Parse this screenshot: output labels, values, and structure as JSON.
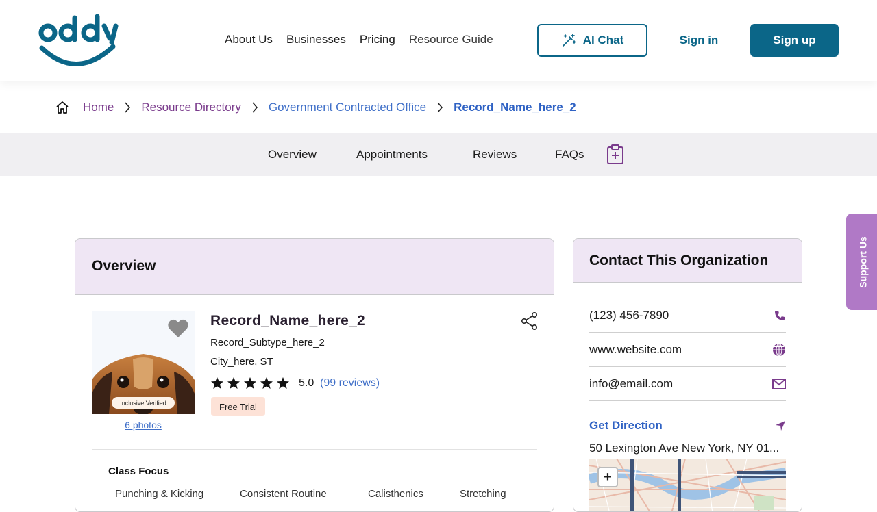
{
  "brand": {
    "logo_text": "oddy",
    "color": "#0b6688"
  },
  "nav": {
    "items": [
      "About Us",
      "Businesses",
      "Pricing",
      "Resource Guide"
    ],
    "ai_chat": "AI Chat",
    "sign_in": "Sign in",
    "sign_up": "Sign up"
  },
  "breadcrumb": {
    "home": "Home",
    "directory": "Resource Directory",
    "category": "Government Contracted Office",
    "current": "Record_Name_here_2"
  },
  "tabs": [
    "Overview",
    "Appointments",
    "Reviews",
    "FAQs"
  ],
  "support": "Support Us",
  "overview": {
    "heading": "Overview",
    "name": "Record_Name_here_2",
    "subtype": "Record_Subtype_here_2",
    "city": "City_here, ST",
    "stars": 5,
    "rating": "5.0",
    "reviews": "(99 reviews)",
    "badge": "Free Trial",
    "verified": "Inclusive Verified",
    "photos": "6 photos",
    "class_focus": "Class Focus",
    "focus_items": [
      "Punching & Kicking",
      "Consistent Routine",
      "Calisthenics",
      "Stretching"
    ]
  },
  "contact": {
    "heading": "Contact This Organization",
    "phone": "(123) 456-7890",
    "website": "www.website.com",
    "email": "info@email.com",
    "get_direction": "Get Direction",
    "address": "50 Lexington Ave New York, NY 01...",
    "map_zoom_in": "+"
  },
  "colors": {
    "primary": "#0b6688",
    "purple": "#7a3b8c",
    "link_blue": "#3f6fc8",
    "card_header": "#efe6f4",
    "support": "#b079c6",
    "badge": "#fde2d7"
  }
}
